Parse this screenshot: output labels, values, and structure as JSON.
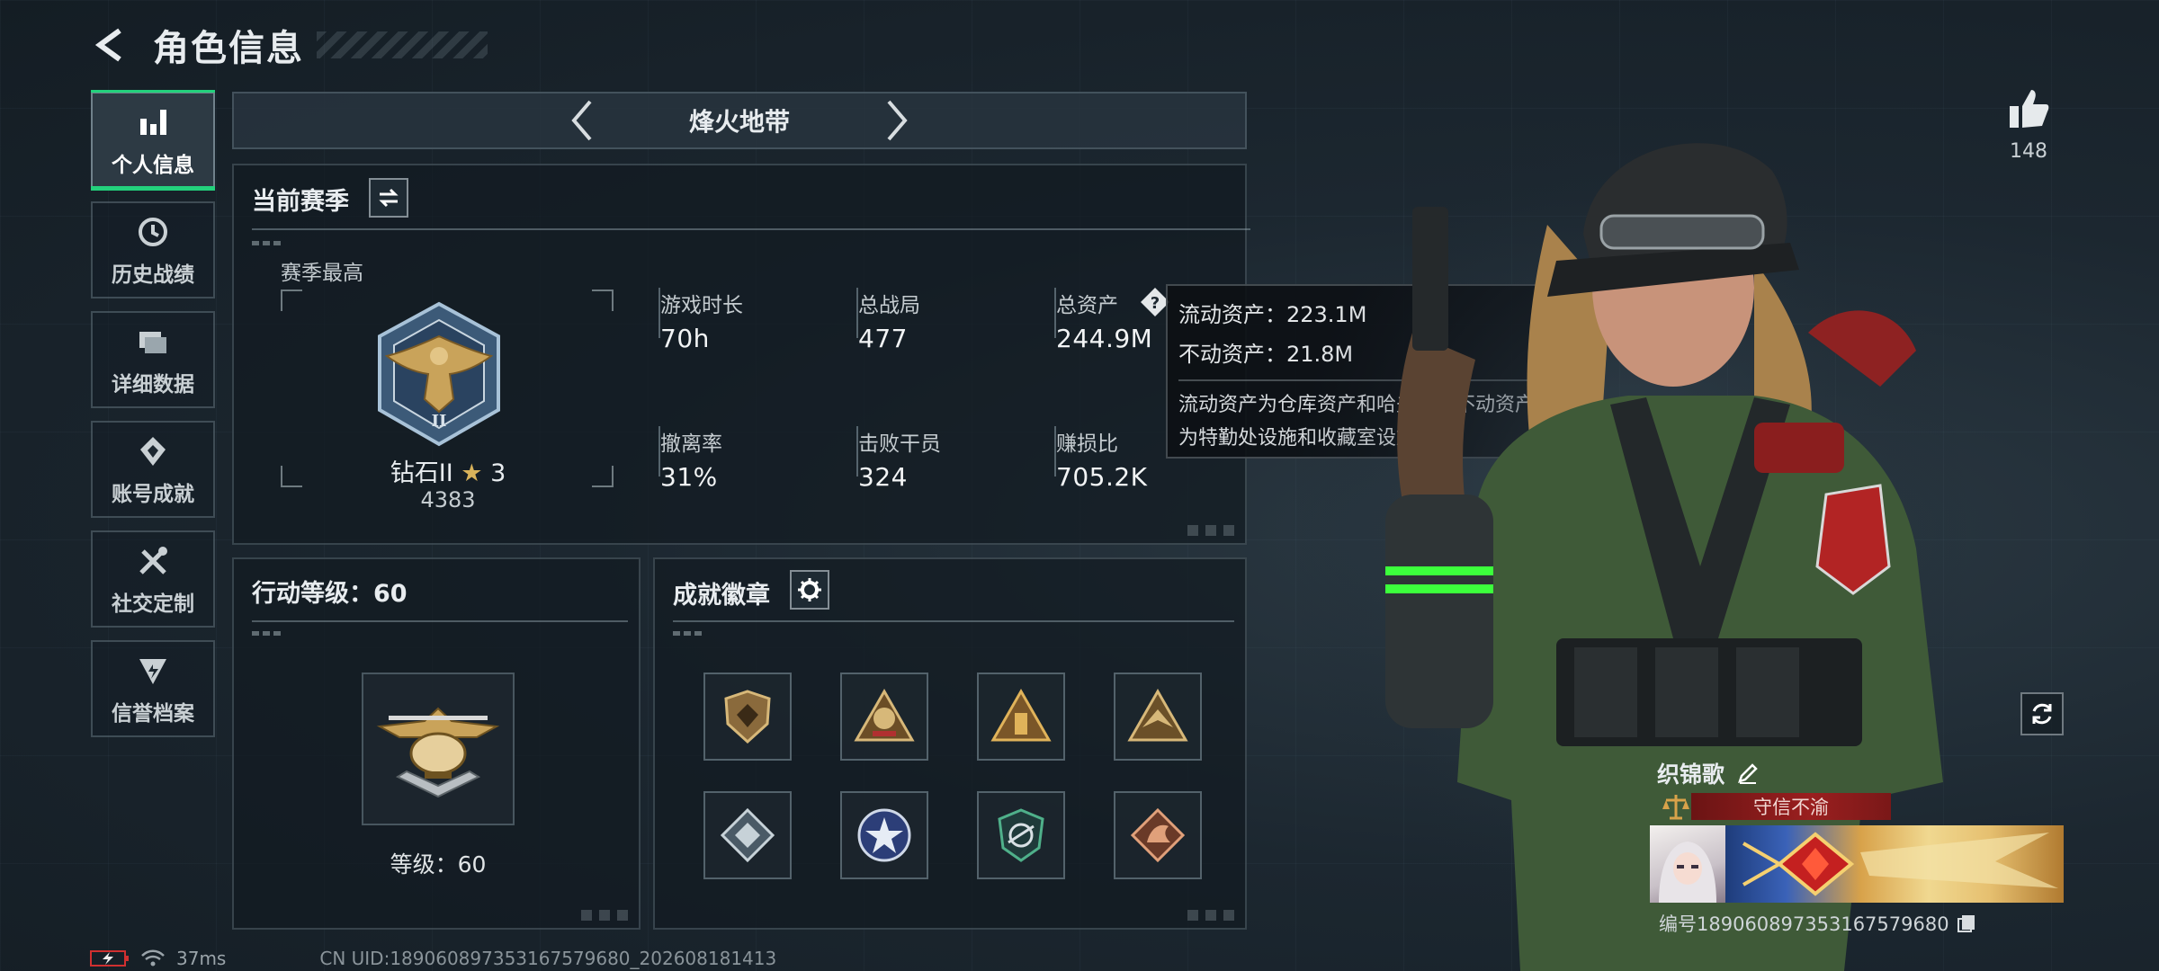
{
  "header": {
    "title": "角色信息"
  },
  "sidebar": {
    "items": [
      {
        "label": "个人信息",
        "icon": "bar-chart-icon",
        "active": true
      },
      {
        "label": "历史战绩",
        "icon": "history-clock-icon"
      },
      {
        "label": "详细数据",
        "icon": "folders-icon"
      },
      {
        "label": "账号成就",
        "icon": "achievement-icon"
      },
      {
        "label": "社交定制",
        "icon": "wrench-screwdriver-icon"
      },
      {
        "label": "信誉档案",
        "icon": "credit-shield-icon"
      }
    ]
  },
  "mode": {
    "title": "烽火地带"
  },
  "season": {
    "title": "当前赛季",
    "best_label": "赛季最高",
    "rank_name": "钻石II",
    "rank_stars": "3",
    "rank_score": "4383",
    "stats": [
      {
        "label": "游戏时长",
        "value": "70h"
      },
      {
        "label": "总战局",
        "value": "477"
      },
      {
        "label": "总资产",
        "value": "244.9M"
      },
      {
        "label": "撤离率",
        "value": "31%"
      },
      {
        "label": "击败干员",
        "value": "324"
      },
      {
        "label": "赚损比",
        "value": "705.2K"
      }
    ]
  },
  "tooltip": {
    "liquid": "流动资产：223.1M",
    "fixed": "不动资产：21.8M",
    "desc_line1": "流动资产为仓库资产和哈夫币，不动资产",
    "desc_line2": "为特勤处设施和收藏室设施"
  },
  "level": {
    "title": "行动等级：60",
    "label": "等级：60"
  },
  "badges": {
    "title": "成就徽章",
    "items": [
      "shield-badge-icon",
      "helmet-badge-icon",
      "pyramid-badge-icon",
      "eagle-badge-icon",
      "diamond-badge-icon",
      "star-badge-icon",
      "wing-badge-icon",
      "dragon-badge-icon"
    ]
  },
  "profile": {
    "likes": "148",
    "name": "织锦歌",
    "title_tag": "守信不渝",
    "id_text": "编号1890608973531675796​80"
  },
  "status": {
    "ping": "37ms",
    "uid": "CN UID:1890608973531675796​80_202608181413"
  },
  "colors": {
    "accent_green": "#23d17c",
    "title_red": "#9a1f1f",
    "gold": "#c9a35a"
  }
}
